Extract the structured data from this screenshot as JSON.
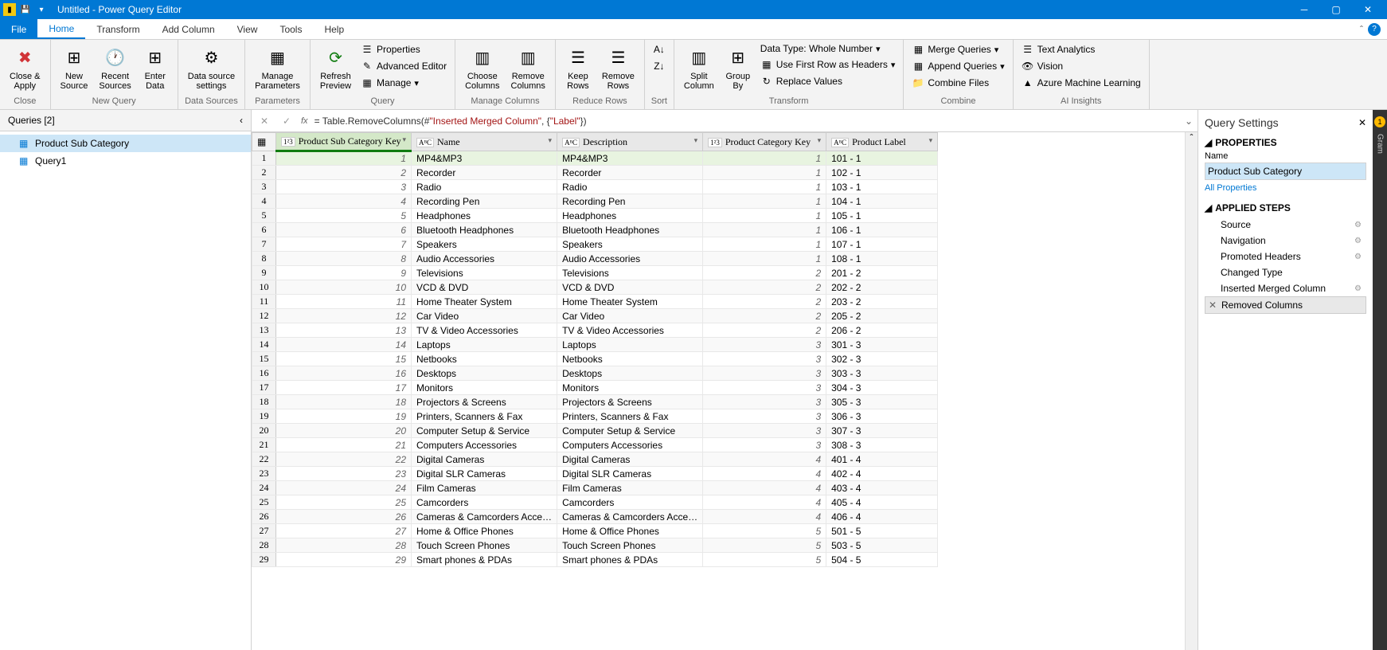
{
  "titlebar": {
    "title": "Untitled - Power Query Editor"
  },
  "tabs": {
    "file": "File",
    "home": "Home",
    "transform": "Transform",
    "add_column": "Add Column",
    "view": "View",
    "tools": "Tools",
    "help": "Help"
  },
  "ribbon": {
    "close": {
      "close_apply": "Close &\nApply",
      "group": "Close"
    },
    "new_query": {
      "new_source": "New\nSource",
      "recent_sources": "Recent\nSources",
      "enter_data": "Enter\nData",
      "group": "New Query"
    },
    "data_sources": {
      "data_source_settings": "Data source\nsettings",
      "group": "Data Sources"
    },
    "parameters": {
      "manage_parameters": "Manage\nParameters",
      "group": "Parameters"
    },
    "query": {
      "refresh_preview": "Refresh\nPreview",
      "properties": "Properties",
      "advanced_editor": "Advanced Editor",
      "manage": "Manage",
      "group": "Query"
    },
    "manage_columns": {
      "choose_columns": "Choose\nColumns",
      "remove_columns": "Remove\nColumns",
      "group": "Manage Columns"
    },
    "reduce_rows": {
      "keep_rows": "Keep\nRows",
      "remove_rows": "Remove\nRows",
      "group": "Reduce Rows"
    },
    "sort": {
      "group": "Sort"
    },
    "transform": {
      "split_column": "Split\nColumn",
      "group_by": "Group\nBy",
      "data_type": "Data Type: Whole Number",
      "first_row_headers": "Use First Row as Headers",
      "replace_values": "Replace Values",
      "group": "Transform"
    },
    "combine": {
      "merge_queries": "Merge Queries",
      "append_queries": "Append Queries",
      "combine_files": "Combine Files",
      "group": "Combine"
    },
    "ai": {
      "text_analytics": "Text Analytics",
      "vision": "Vision",
      "azure_ml": "Azure Machine Learning",
      "group": "AI Insights"
    }
  },
  "queries": {
    "title": "Queries [2]",
    "items": [
      {
        "name": "Product Sub Category",
        "selected": true
      },
      {
        "name": "Query1",
        "selected": false
      }
    ]
  },
  "formula": {
    "prefix": "= Table.RemoveColumns(#",
    "arg1": "\"Inserted Merged Column\"",
    "mid": ", {",
    "arg2": "\"Label\"",
    "suffix": "})"
  },
  "columns": [
    {
      "name": "Product Sub Category Key",
      "type": "1²3",
      "selected": true
    },
    {
      "name": "Name",
      "type": "AᴮC",
      "selected": false
    },
    {
      "name": "Description",
      "type": "AᴮC",
      "selected": false
    },
    {
      "name": "Product Category Key",
      "type": "1²3",
      "selected": false
    },
    {
      "name": "Product Label",
      "type": "AᴮC",
      "selected": false
    }
  ],
  "rows": [
    [
      1,
      "MP4&MP3",
      "MP4&MP3",
      1,
      "101 - 1"
    ],
    [
      2,
      "Recorder",
      "Recorder",
      1,
      "102 - 1"
    ],
    [
      3,
      "Radio",
      "Radio",
      1,
      "103 - 1"
    ],
    [
      4,
      "Recording Pen",
      "Recording Pen",
      1,
      "104 - 1"
    ],
    [
      5,
      "Headphones",
      "Headphones",
      1,
      "105 - 1"
    ],
    [
      6,
      "Bluetooth Headphones",
      "Bluetooth Headphones",
      1,
      "106 - 1"
    ],
    [
      7,
      "Speakers",
      "Speakers",
      1,
      "107 - 1"
    ],
    [
      8,
      "Audio Accessories",
      "Audio Accessories",
      1,
      "108 - 1"
    ],
    [
      9,
      "Televisions",
      "Televisions",
      2,
      "201 - 2"
    ],
    [
      10,
      "VCD & DVD",
      "VCD & DVD",
      2,
      "202 - 2"
    ],
    [
      11,
      "Home Theater System",
      "Home Theater System",
      2,
      "203 - 2"
    ],
    [
      12,
      "Car Video",
      "Car Video",
      2,
      "205 - 2"
    ],
    [
      13,
      "TV & Video Accessories",
      "TV & Video Accessories",
      2,
      "206 - 2"
    ],
    [
      14,
      "Laptops",
      "Laptops",
      3,
      "301 - 3"
    ],
    [
      15,
      "Netbooks",
      "Netbooks",
      3,
      "302 - 3"
    ],
    [
      16,
      "Desktops",
      "Desktops",
      3,
      "303 - 3"
    ],
    [
      17,
      "Monitors",
      "Monitors",
      3,
      "304 - 3"
    ],
    [
      18,
      "Projectors & Screens",
      "Projectors & Screens",
      3,
      "305 - 3"
    ],
    [
      19,
      "Printers, Scanners & Fax",
      "Printers, Scanners & Fax",
      3,
      "306 - 3"
    ],
    [
      20,
      "Computer Setup & Service",
      "Computer Setup & Service",
      3,
      "307 - 3"
    ],
    [
      21,
      "Computers Accessories",
      "Computers Accessories",
      3,
      "308 - 3"
    ],
    [
      22,
      "Digital Cameras",
      "Digital Cameras",
      4,
      "401 - 4"
    ],
    [
      23,
      "Digital SLR Cameras",
      "Digital SLR Cameras",
      4,
      "402 - 4"
    ],
    [
      24,
      "Film Cameras",
      "Film Cameras",
      4,
      "403 - 4"
    ],
    [
      25,
      "Camcorders",
      "Camcorders",
      4,
      "405 - 4"
    ],
    [
      26,
      "Cameras & Camcorders Acce…",
      "Cameras & Camcorders Acce…",
      4,
      "406 - 4"
    ],
    [
      27,
      "Home & Office Phones",
      "Home & Office Phones",
      5,
      "501 - 5"
    ],
    [
      28,
      "Touch Screen Phones",
      "Touch Screen Phones",
      5,
      "503 - 5"
    ],
    [
      29,
      "Smart phones & PDAs",
      "Smart phones & PDAs",
      5,
      "504 - 5"
    ]
  ],
  "settings": {
    "title": "Query Settings",
    "properties": "PROPERTIES",
    "name_label": "Name",
    "name_value": "Product Sub Category",
    "all_properties": "All Properties",
    "applied_steps": "APPLIED STEPS",
    "steps": [
      {
        "name": "Source",
        "gear": true
      },
      {
        "name": "Navigation",
        "gear": true
      },
      {
        "name": "Promoted Headers",
        "gear": true
      },
      {
        "name": "Changed Type",
        "gear": false
      },
      {
        "name": "Inserted Merged Column",
        "gear": true
      },
      {
        "name": "Removed Columns",
        "gear": false,
        "selected": true
      }
    ]
  }
}
